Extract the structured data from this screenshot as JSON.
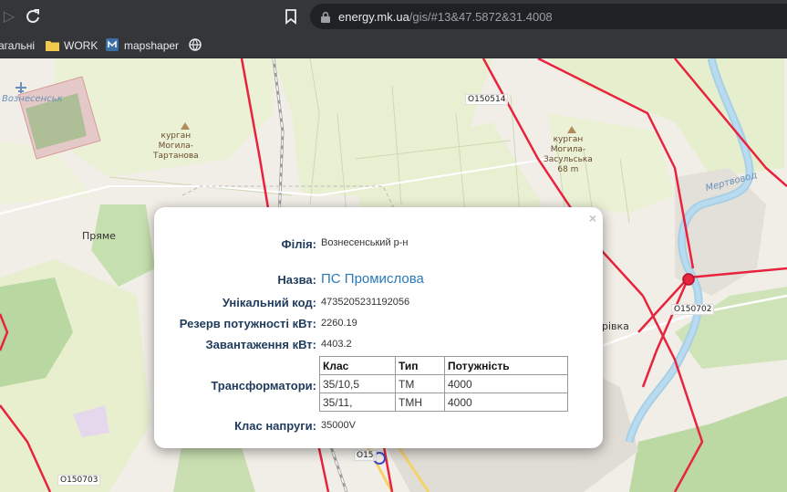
{
  "browser": {
    "url_host": "energy.mk.ua",
    "url_rest": "/gis/#13&47.5872&31.4008"
  },
  "bookmarks": [
    {
      "label": "агальні"
    },
    {
      "label": "WORK"
    },
    {
      "label": "mapshaper"
    }
  ],
  "map": {
    "labels": {
      "voznesensk": "Вознесенськ",
      "kurgan_left": "курган\nМогила-\nТартанова",
      "kurgan_right": "курган\nМогила-\nЗасульська\n68 m",
      "pryame": "Пряме",
      "mertvovod": "Мертвовод",
      "rivka": "рівка",
      "o150514": "O150514",
      "o150702": "O150702",
      "o150703": "O150703",
      "o150_bottom": "O15"
    }
  },
  "popup": {
    "close": "×",
    "fields": {
      "filiya_label": "Філія:",
      "filiya_value": "Вознесенський р-н",
      "nazva_label": "Назва:",
      "nazva_value": "ПС Промислова",
      "code_label": "Унікальний код:",
      "code_value": "4735205231192056",
      "reserve_label": "Резерв потужності кВт:",
      "reserve_value": "2260.19",
      "load_label": "Завантаження кВт:",
      "load_value": "4403.2",
      "transformers_label": "Трансформатори:",
      "voltage_label": "Клас напруги:",
      "voltage_value": "35000V"
    },
    "transformers": {
      "headers": [
        "Клас",
        "Тип",
        "Потужність"
      ],
      "rows": [
        [
          "35/10,5",
          "ТМ",
          "4000"
        ],
        [
          "35/11,",
          "ТМН",
          "4000"
        ]
      ]
    }
  }
}
